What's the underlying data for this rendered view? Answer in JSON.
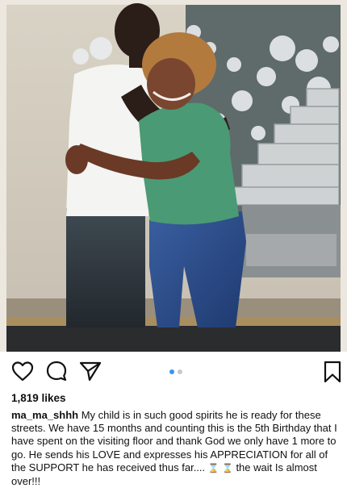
{
  "post": {
    "likes": "1,819 likes",
    "username": "ma_ma_shhh",
    "caption_main": "My child is in such good spirits he is ready for these streets. We have 15 months and counting this is the 5th Birthday that I have spent on the visiting floor and thank God we only have 1 more to go. He sends his LOVE and expresses his APPRECIATION for all of the SUPPORT he has received thus far....",
    "emoji": "⌛",
    "caption_end": "the wait Is almost over!!!",
    "carousel": {
      "count": 2,
      "active": 0
    }
  },
  "icons": {
    "like": "heart-icon",
    "comment": "comment-icon",
    "share": "paper-plane-icon",
    "save": "bookmark-icon"
  },
  "colors": {
    "accent_dot": "#3897f0",
    "inactive_dot": "#c8c8c8",
    "text": "#111111"
  }
}
